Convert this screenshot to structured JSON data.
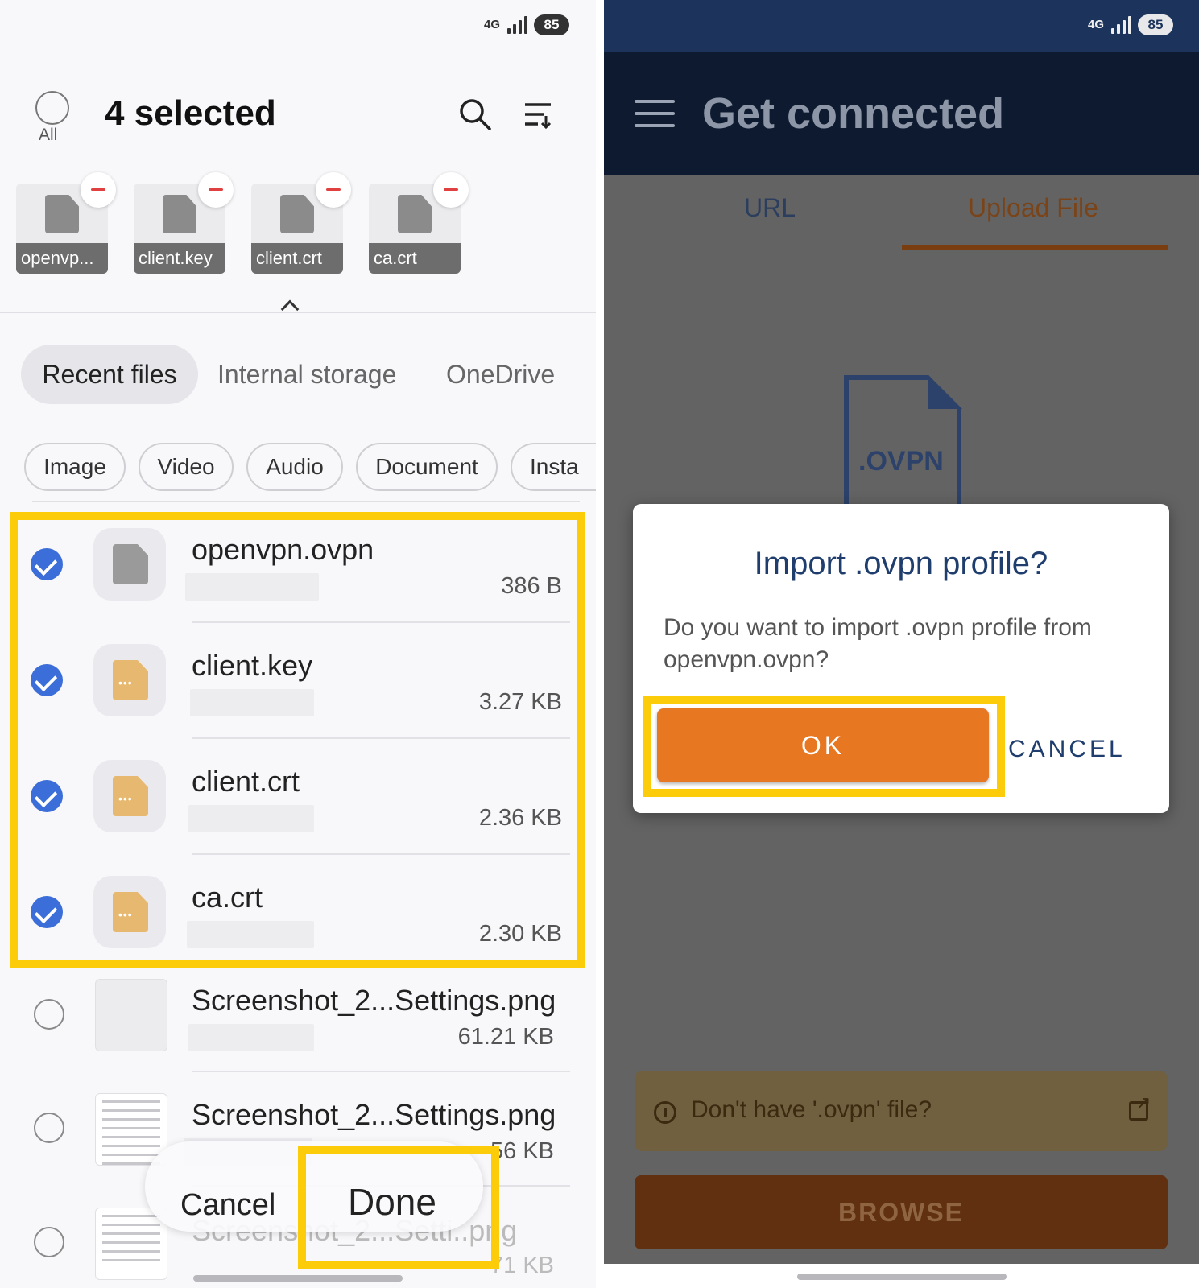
{
  "left": {
    "status": {
      "network": "4G",
      "battery": "85"
    },
    "header": {
      "all_label": "All",
      "title": "4 selected"
    },
    "selected_thumbs": [
      {
        "name": "openvp..."
      },
      {
        "name": "client.key"
      },
      {
        "name": "client.crt"
      },
      {
        "name": "ca.crt"
      }
    ],
    "tabs": [
      "Recent files",
      "Internal storage",
      "OneDrive"
    ],
    "filters": [
      "Image",
      "Video",
      "Audio",
      "Document",
      "Insta"
    ],
    "files": [
      {
        "name": "openvpn.ovpn",
        "size": "386 B",
        "checked": true,
        "icon": "generic-file-icon"
      },
      {
        "name": "client.key",
        "size": "3.27 KB",
        "checked": true,
        "icon": "unknown-file-icon"
      },
      {
        "name": "client.crt",
        "size": "2.36 KB",
        "checked": true,
        "icon": "unknown-file-icon"
      },
      {
        "name": "ca.crt",
        "size": "2.30 KB",
        "checked": true,
        "icon": "unknown-file-icon"
      },
      {
        "name": "Screenshot_2...Settings.png",
        "size": "61.21 KB",
        "checked": false,
        "icon": "image-thumbnail"
      },
      {
        "name": "Screenshot_2...Settings.png",
        "size": "56 KB",
        "checked": false,
        "icon": "image-thumbnail"
      },
      {
        "name": "Screenshot_2...Setti..png",
        "size": "71 KB",
        "checked": false,
        "icon": "image-thumbnail"
      }
    ],
    "actions": {
      "cancel": "Cancel",
      "done": "Done"
    },
    "highlight_color": "#fccc0a"
  },
  "right": {
    "status": {
      "network": "4G",
      "battery": "85"
    },
    "appbar": {
      "title": "Get connected"
    },
    "tabs": [
      {
        "label": "URL",
        "active": false
      },
      {
        "label": "Upload File",
        "active": true
      }
    ],
    "file_badge": ".OVPN",
    "dialog": {
      "title": "Import .ovpn profile?",
      "message": "Do you want to import .ovpn profile from openvpn.ovpn?",
      "ok": "OK",
      "cancel": "CANCEL"
    },
    "hint": "Don't have '.ovpn' file?",
    "browse": "BROWSE",
    "accent_color": "#e87722",
    "primary_color": "#1f3e6d"
  }
}
